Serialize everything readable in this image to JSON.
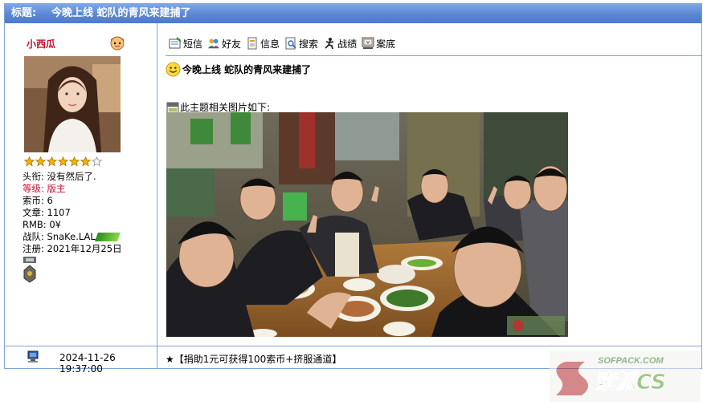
{
  "title_bar": {
    "label": "标题:",
    "text": "今晚上线 蛇队的青风来建捕了"
  },
  "user": {
    "name": "小西瓜",
    "rank_stars": 6,
    "info": {
      "title": "头衔: 没有然后了.",
      "level": "等级: 版主",
      "coins": "索币: 6",
      "posts": "文章: 1107",
      "rmb": "RMB: 0¥",
      "team": "战队: SnaKe.LAL",
      "registered": "注册: 2021年12月25日"
    }
  },
  "toolbar": {
    "items": [
      {
        "label": "短信",
        "icon": "message-icon"
      },
      {
        "label": "好友",
        "icon": "friends-icon"
      },
      {
        "label": "信息",
        "icon": "info-icon"
      },
      {
        "label": "搜索",
        "icon": "search-icon"
      },
      {
        "label": "战绩",
        "icon": "stats-icon"
      },
      {
        "label": "案底",
        "icon": "record-icon"
      }
    ]
  },
  "post": {
    "heading": "今晚上线 蛇队的青风来建捕了",
    "attachment_label": "此主题相关图片如下:"
  },
  "footer": {
    "datetime": "2024-11-26 19:37:00",
    "message": "★【捐助1元可获得100索币+挤服通道】"
  },
  "watermark": {
    "text": "SOFPACK.COM 索派CS"
  },
  "colors": {
    "title_bar": "#5a86d3",
    "border": "#7fa3d9",
    "username": "#c8102e"
  }
}
